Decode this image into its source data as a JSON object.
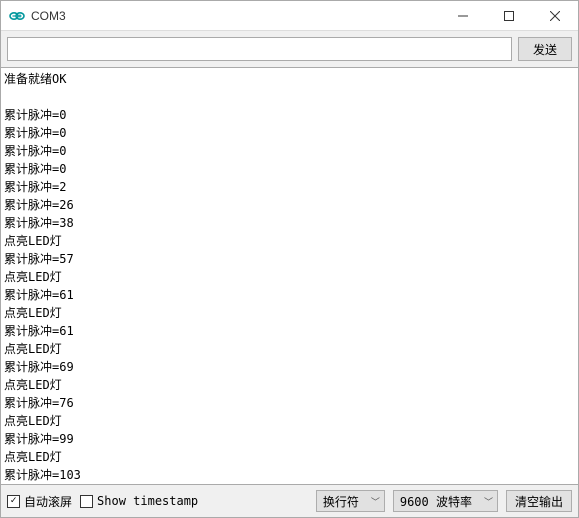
{
  "titlebar": {
    "title": "COM3"
  },
  "sendrow": {
    "input_value": "",
    "input_placeholder": "",
    "button_label": "发送"
  },
  "output_lines": [
    "准备就绪OK",
    "",
    "累计脉冲=0",
    "累计脉冲=0",
    "累计脉冲=0",
    "累计脉冲=0",
    "累计脉冲=2",
    "累计脉冲=26",
    "累计脉冲=38",
    "点亮LED灯",
    "累计脉冲=57",
    "点亮LED灯",
    "累计脉冲=61",
    "点亮LED灯",
    "累计脉冲=61",
    "点亮LED灯",
    "累计脉冲=69",
    "点亮LED灯",
    "累计脉冲=76",
    "点亮LED灯",
    "累计脉冲=99",
    "点亮LED灯",
    "累计脉冲=103"
  ],
  "bottom": {
    "autoscroll_label": "自动滚屏",
    "autoscroll_checked": true,
    "timestamp_label": "Show timestamp",
    "timestamp_checked": false,
    "lineending_selected": "换行符",
    "baud_selected": "9600 波特率",
    "clear_label": "清空输出"
  }
}
